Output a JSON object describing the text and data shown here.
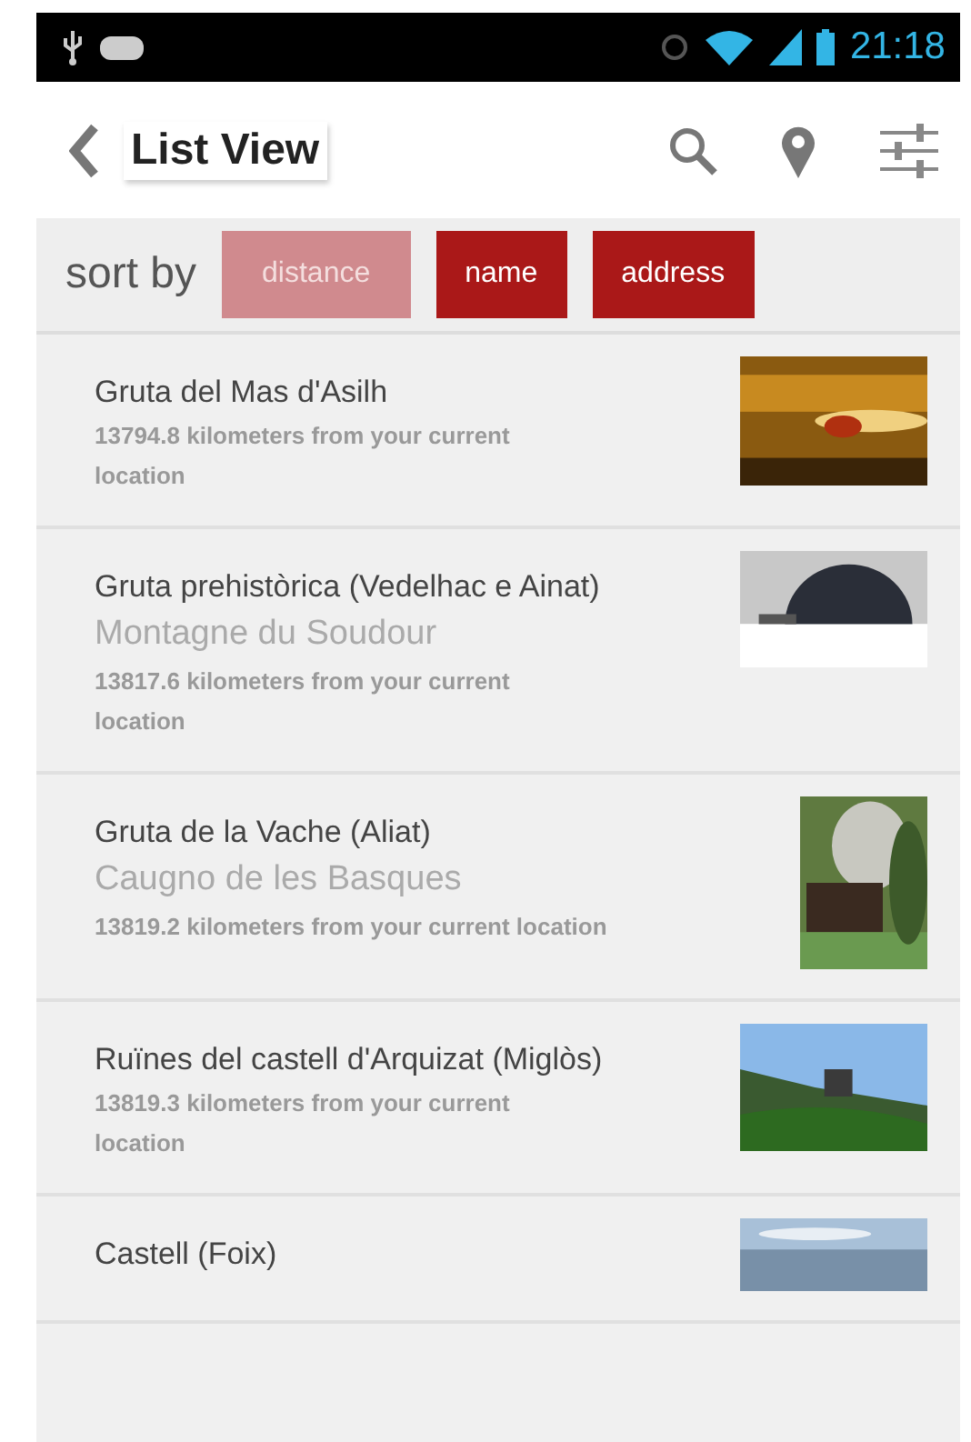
{
  "status_bar": {
    "time": "21:18"
  },
  "header": {
    "title": "List View"
  },
  "sort": {
    "label": "sort by",
    "options": [
      {
        "label": "distance",
        "selected": true
      },
      {
        "label": "name",
        "selected": false
      },
      {
        "label": "address",
        "selected": false
      }
    ]
  },
  "places": [
    {
      "name": "Gruta del Mas d'Asilh",
      "distance": "13794.8 kilometers from your current location"
    },
    {
      "name": "Gruta prehistòrica (Vedelhac e Ainat)",
      "address": "Montagne du Soudour",
      "distance": "13817.6 kilometers from your current location"
    },
    {
      "name": "Gruta de la Vache (Aliat)",
      "address": "Caugno de les Basques",
      "distance": "13819.2 kilometers from your current location"
    },
    {
      "name": "Ruïnes del castell d'Arquizat (Miglòs)",
      "distance": "13819.3 kilometers from your current location"
    },
    {
      "name": "Castell (Foix)"
    }
  ]
}
